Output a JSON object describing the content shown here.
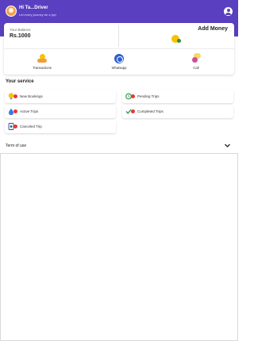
{
  "header": {
    "greeting": "Hi Ta...Driver",
    "subtitle": "Let every journey be a joy!",
    "background_color": "#5a3fc0"
  },
  "balance": {
    "label": "Your Balance",
    "amount": "Rs.1000",
    "add_money_label": "Add Money"
  },
  "actions": [
    {
      "label": "Transactions",
      "icon": "transactions-icon"
    },
    {
      "label": "Whatsapp",
      "icon": "whatsapp-icon"
    },
    {
      "label": "Call",
      "icon": "call-icon"
    }
  ],
  "services": {
    "title": "Your service",
    "items": [
      {
        "label": "New Bookings",
        "icon": "bulb-icon"
      },
      {
        "label": "Pending Trips",
        "icon": "pending-icon"
      },
      {
        "label": "Active Trips",
        "icon": "active-icon"
      },
      {
        "label": "Completed Trips",
        "icon": "check-icon"
      },
      {
        "label": "Canceled Trip",
        "icon": "cancel-icon"
      }
    ]
  },
  "terms": {
    "label": "Term of use"
  }
}
